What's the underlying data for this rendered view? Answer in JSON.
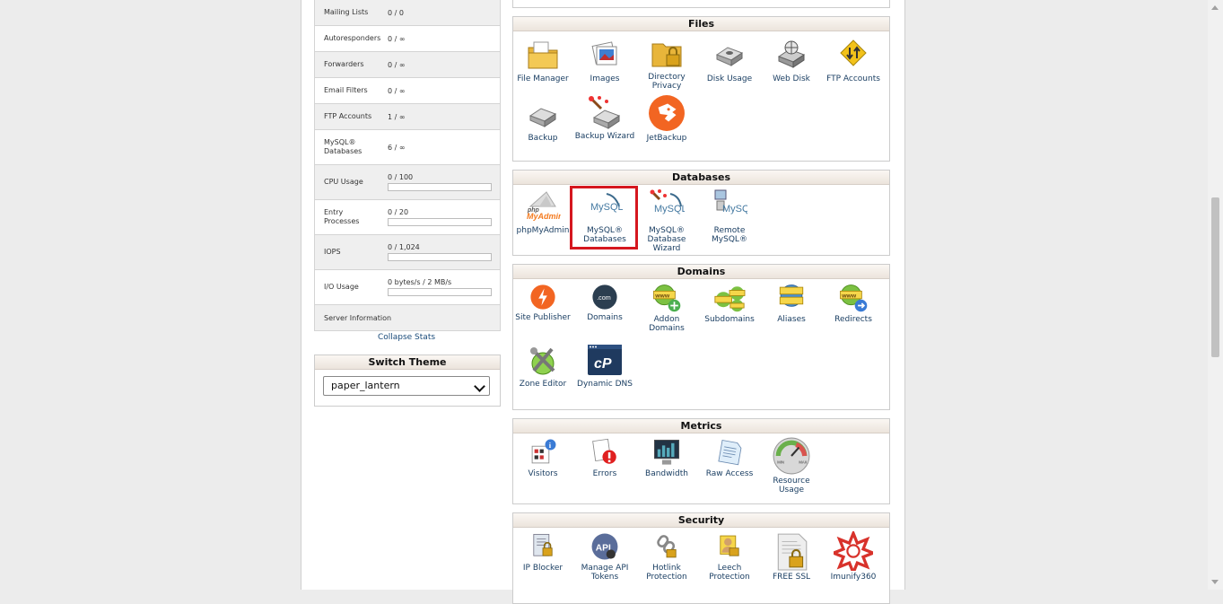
{
  "stats": {
    "rows": [
      {
        "label": "Mailing Lists",
        "value": "0 / 0"
      },
      {
        "label": "Autoresponders",
        "value": "0 / ∞"
      },
      {
        "label": "Forwarders",
        "value": "0 / ∞"
      },
      {
        "label": "Email Filters",
        "value": "0 / ∞"
      },
      {
        "label": "FTP Accounts",
        "value": "1 / ∞"
      },
      {
        "label": "MySQL® Databases",
        "value": "6 / ∞"
      },
      {
        "label": "CPU Usage",
        "value": "0 / 100",
        "fill": 0
      },
      {
        "label": "Entry Processes",
        "value": "0 / 20",
        "fill": 0
      },
      {
        "label": "IOPS",
        "value": "0 / 1,024",
        "fill": 0
      },
      {
        "label": "I/O Usage",
        "value": "0 bytes/s / 2 MB/s",
        "fill": 0
      }
    ],
    "server_info": "Server Information",
    "collapse": "Collapse Stats"
  },
  "theme": {
    "title": "Switch Theme",
    "selected": "paper_lantern"
  },
  "sections": {
    "files": {
      "title": "Files",
      "items": [
        "File Manager",
        "Images",
        "Directory Privacy",
        "Disk Usage",
        "Web Disk",
        "FTP Accounts",
        "Backup",
        "Backup Wizard",
        "JetBackup"
      ]
    },
    "databases": {
      "title": "Databases",
      "items": [
        "phpMyAdmin",
        "MySQL® Databases",
        "MySQL® Database Wizard",
        "Remote MySQL®"
      ]
    },
    "domains": {
      "title": "Domains",
      "items": [
        "Site Publisher",
        "Domains",
        "Addon Domains",
        "Subdomains",
        "Aliases",
        "Redirects",
        "Zone Editor",
        "Dynamic DNS"
      ]
    },
    "metrics": {
      "title": "Metrics",
      "items": [
        "Visitors",
        "Errors",
        "Bandwidth",
        "Raw Access",
        "Resource Usage"
      ]
    },
    "security": {
      "title": "Security",
      "items": [
        "IP Blocker",
        "Manage API Tokens",
        "Hotlink Protection",
        "Leech Protection",
        "FREE SSL",
        "Imunify360"
      ]
    }
  },
  "icons": {
    "php_text": "php",
    "myadmin_text": "MyAdmin",
    "mysql_text": "MySQL",
    "com_text": ".com",
    "www_text": "www",
    "cp_text": "cP",
    "api_text": "API",
    "meter_min": "MIN",
    "meter_max": "MAX"
  },
  "colors": {
    "link": "#1b3f63",
    "highlight": "#d5171f",
    "jetbackup": "#f26522",
    "orange": "#f47b20"
  }
}
